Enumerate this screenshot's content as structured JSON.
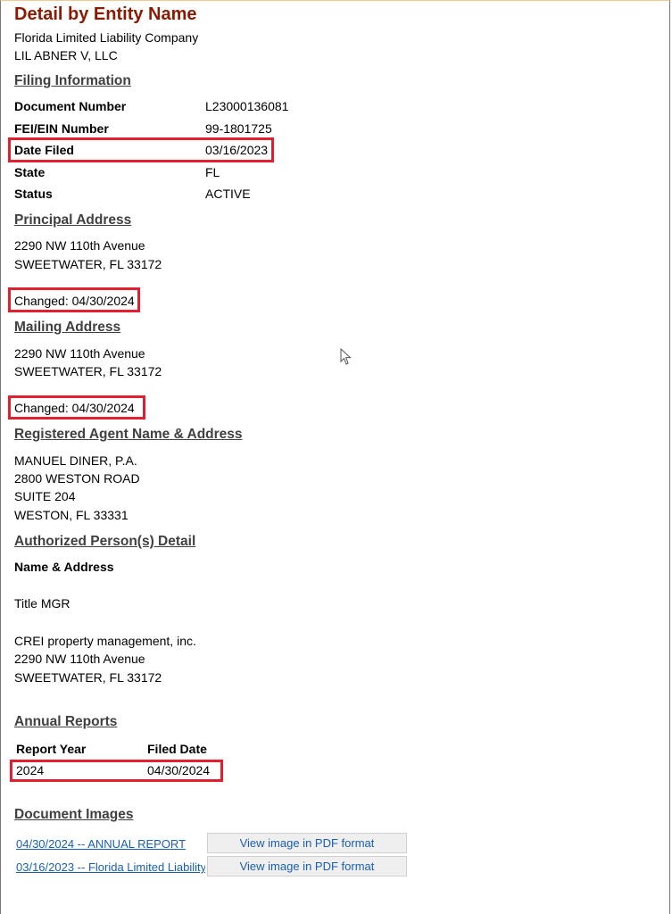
{
  "header": {
    "title": "Detail by Entity Name",
    "entity_type": "Florida Limited Liability Company",
    "entity_name": "LIL ABNER V, LLC"
  },
  "filing": {
    "heading": "Filing Information",
    "rows": [
      {
        "label": "Document Number",
        "value": "L23000136081"
      },
      {
        "label": "FEI/EIN Number",
        "value": "99-1801725"
      },
      {
        "label": "Date Filed",
        "value": "03/16/2023"
      },
      {
        "label": "State",
        "value": "FL"
      },
      {
        "label": "Status",
        "value": "ACTIVE"
      }
    ]
  },
  "principal": {
    "heading": "Principal Address",
    "lines": [
      "2290 NW 110th Avenue",
      "SWEETWATER, FL 33172"
    ],
    "changed": "Changed: 04/30/2024"
  },
  "mailing": {
    "heading": "Mailing Address",
    "lines": [
      "2290 NW 110th Avenue",
      "SWEETWATER, FL 33172"
    ],
    "changed": "Changed: 04/30/2024"
  },
  "agent": {
    "heading": "Registered Agent Name & Address",
    "lines": [
      "MANUEL DINER, P.A.",
      "2800 WESTON ROAD",
      "SUITE 204",
      "WESTON, FL 33331"
    ]
  },
  "authorized": {
    "heading": "Authorized Person(s) Detail",
    "subheading": "Name & Address",
    "title_line": "Title MGR",
    "lines": [
      "CREI property management, inc.",
      "2290 NW 110th Avenue",
      "SWEETWATER, FL 33172"
    ]
  },
  "annual": {
    "heading": "Annual Reports",
    "col_year": "Report Year",
    "col_date": "Filed Date",
    "rows": [
      {
        "year": "2024",
        "date": "04/30/2024"
      }
    ]
  },
  "images": {
    "heading": "Document Images",
    "items": [
      {
        "link": "04/30/2024 -- ANNUAL REPORT",
        "button": "View image in PDF format"
      },
      {
        "link": "03/16/2023 -- Florida Limited Liability",
        "button": "View image in PDF format"
      }
    ]
  }
}
